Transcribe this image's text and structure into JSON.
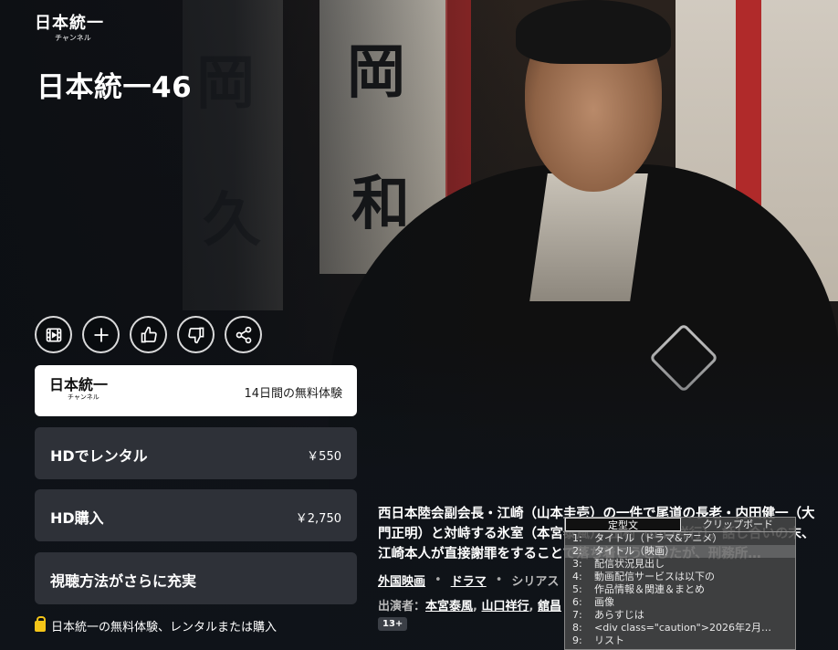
{
  "channel": {
    "logo_main": "日本統一",
    "logo_sub": "チャンネル"
  },
  "title": "日本統一46",
  "actions": [
    {
      "name": "trailer-icon"
    },
    {
      "name": "add-icon"
    },
    {
      "name": "thumbs-up-icon"
    },
    {
      "name": "thumbs-down-icon"
    },
    {
      "name": "share-icon"
    }
  ],
  "trial_card": {
    "logo_main": "日本統一",
    "logo_sub": "チャンネル",
    "text": "14日間の無料体験"
  },
  "options": [
    {
      "label": "HDでレンタル",
      "price": "￥550"
    },
    {
      "label": "HD購入",
      "price": "￥2,750"
    },
    {
      "label": "視聴方法がさらに充実",
      "price": ""
    }
  ],
  "note": "日本統一の無料体験、レンタルまたは購入",
  "synopsis": "西日本陸会副会長・江崎（山本圭壱）の一件で尾道の長老・内田健一（大門正明）と対峙する氷室（本宮泰風）、田村（山口祥行）。話し合いの末、江崎本人が直接謝罪をすることで落ち着こうとしたが、刑務所…",
  "genres": {
    "g1": "外国映画",
    "g2": "ドラマ",
    "g3": "シリアス"
  },
  "cast": {
    "label": "出演者：",
    "c1": "本宮泰風",
    "c2": "山口祥行",
    "c3": "舘昌"
  },
  "rating": "13+",
  "ime": {
    "tabs": [
      "定型文",
      "クリップボード"
    ],
    "rows": [
      {
        "num": "1:",
        "text": "タイトル（ドラマ&アニメ）"
      },
      {
        "num": "2:",
        "text": "タイトル（映画）"
      },
      {
        "num": "3:",
        "text": "配信状況見出し"
      },
      {
        "num": "4:",
        "text": "動画配信サービスは以下の"
      },
      {
        "num": "5:",
        "text": "作品情報＆関連＆まとめ"
      },
      {
        "num": "6:",
        "text": "画像"
      },
      {
        "num": "7:",
        "text": "あらすじは"
      },
      {
        "num": "8:",
        "text": "<div class=\"caution\">2026年2月…"
      },
      {
        "num": "9:",
        "text": "リスト"
      }
    ]
  }
}
